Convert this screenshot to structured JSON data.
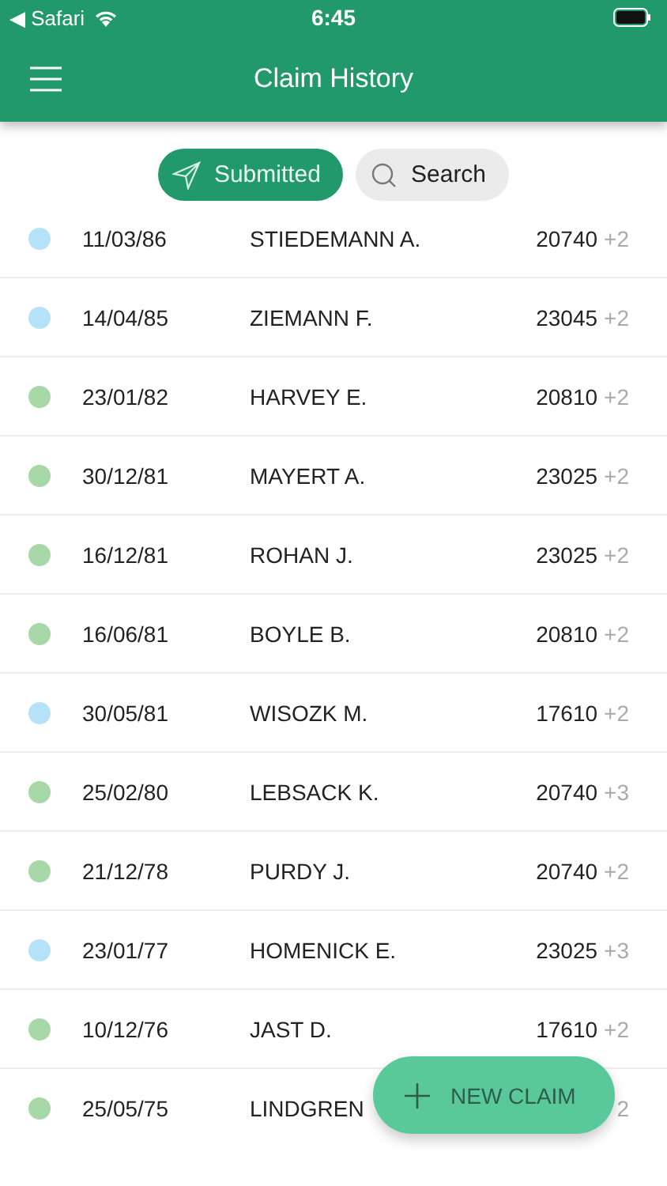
{
  "status_bar": {
    "back_label": "◀ Safari",
    "time": "6:45"
  },
  "header": {
    "title": "Claim History"
  },
  "filters": [
    {
      "label": "Submitted",
      "kind": "submitted",
      "selected": true
    },
    {
      "label": "Search",
      "kind": "search",
      "selected": false
    }
  ],
  "claims": [
    {
      "date": "11/03/86",
      "name": "STIEDEMANN A.",
      "amount": "20740",
      "extra": "+2",
      "color": "#b6e2f7"
    },
    {
      "date": "14/04/85",
      "name": "ZIEMANN F.",
      "amount": "23045",
      "extra": "+2",
      "color": "#b6e2f7"
    },
    {
      "date": "23/01/82",
      "name": "HARVEY E.",
      "amount": "20810",
      "extra": "+2",
      "color": "#a8d8a8"
    },
    {
      "date": "30/12/81",
      "name": "MAYERT A.",
      "amount": "23025",
      "extra": "+2",
      "color": "#a8d8a8"
    },
    {
      "date": "16/12/81",
      "name": "ROHAN J.",
      "amount": "23025",
      "extra": "+2",
      "color": "#a8d8a8"
    },
    {
      "date": "16/06/81",
      "name": "BOYLE B.",
      "amount": "20810",
      "extra": "+2",
      "color": "#a8d8a8"
    },
    {
      "date": "30/05/81",
      "name": "WISOZK M.",
      "amount": "17610",
      "extra": "+2",
      "color": "#b6e2f7"
    },
    {
      "date": "25/02/80",
      "name": "LEBSACK K.",
      "amount": "20740",
      "extra": "+3",
      "color": "#a8d8a8"
    },
    {
      "date": "21/12/78",
      "name": "PURDY J.",
      "amount": "20740",
      "extra": "+2",
      "color": "#a8d8a8"
    },
    {
      "date": "23/01/77",
      "name": "HOMENICK E.",
      "amount": "23025",
      "extra": "+3",
      "color": "#b6e2f7"
    },
    {
      "date": "10/12/76",
      "name": "JAST D.",
      "amount": "17610",
      "extra": "+2",
      "color": "#a8d8a8"
    },
    {
      "date": "25/05/75",
      "name": "LINDGREN",
      "extra": "2",
      "color": "#a8d8a8"
    }
  ],
  "fab": {
    "label": "NEW CLAIM"
  }
}
